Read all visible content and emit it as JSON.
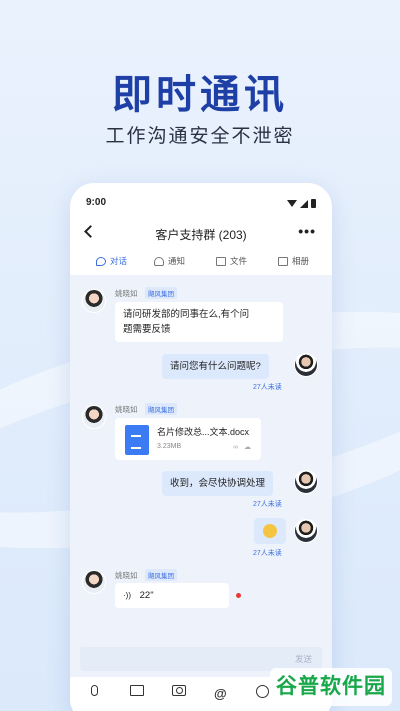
{
  "hero": {
    "title": "即时通讯",
    "subtitle": "工作沟通安全不泄密"
  },
  "status_bar": {
    "time": "9:00"
  },
  "header": {
    "back_icon": "back-arrow-icon",
    "title": "客户支持群 (203)",
    "more_label": "•••"
  },
  "tabs": [
    {
      "label": "对话",
      "icon": "chat-bubble-icon",
      "active": true
    },
    {
      "label": "通知",
      "icon": "bell-icon",
      "active": false
    },
    {
      "label": "文件",
      "icon": "folder-icon",
      "active": false
    },
    {
      "label": "相册",
      "icon": "photo-icon",
      "active": false
    }
  ],
  "messages": [
    {
      "direction": "in",
      "sender": "姚晓如",
      "org": "飓风集团",
      "text_line1": "请问研发部的同事在么,有个问",
      "text_line2": "题需要反馈"
    },
    {
      "direction": "out",
      "text": "请问您有什么问题呢?",
      "read": "27人未读"
    },
    {
      "direction": "in",
      "sender": "姚晓如",
      "org": "飓风集团",
      "file": {
        "name": "名片修改总...文本.docx",
        "size": "3.23MB",
        "actions": "∞ ☁"
      }
    },
    {
      "direction": "out",
      "text": "收到，会尽快协调处理",
      "read": "27人未读"
    },
    {
      "direction": "out",
      "emoji": "smile",
      "read": "27人未读"
    },
    {
      "direction": "in",
      "sender": "姚晓如",
      "org": "飓风集团",
      "voice": {
        "wave": "·))",
        "duration": "22\""
      },
      "unread": true
    }
  ],
  "input": {
    "send_label": "发送"
  },
  "toolbar": [
    "mic-icon",
    "image-icon",
    "camera-icon",
    "at-icon",
    "emoji-icon"
  ],
  "toolbar_at_label": "@",
  "watermark": "谷普软件园",
  "colors": {
    "accent": "#3b6fe0",
    "hero_title": "#1e3fa6",
    "outgoing_bubble": "#dce8fb",
    "watermark": "#18a84a"
  }
}
